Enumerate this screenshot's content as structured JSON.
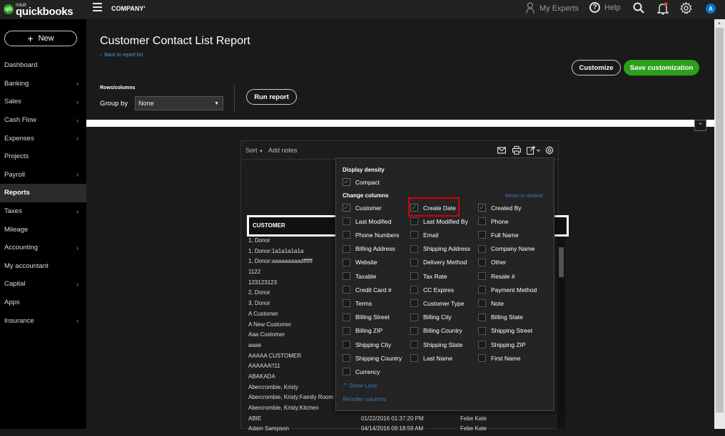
{
  "topbar": {
    "logo_intuit": "intuit",
    "logo_name": "quickbooks",
    "company": "COMPANY'",
    "my_experts": "My Experts",
    "help": "Help",
    "avatar_initial": "A"
  },
  "sidebar": {
    "new_label": "New",
    "items": [
      {
        "label": "Dashboard",
        "chev": false,
        "active": false
      },
      {
        "label": "Banking",
        "chev": true,
        "active": false
      },
      {
        "label": "Sales",
        "chev": true,
        "active": false
      },
      {
        "label": "Cash Flow",
        "chev": true,
        "active": false
      },
      {
        "label": "Expenses",
        "chev": true,
        "active": false
      },
      {
        "label": "Projects",
        "chev": false,
        "active": false
      },
      {
        "label": "Payroll",
        "chev": true,
        "active": false
      },
      {
        "label": "Reports",
        "chev": false,
        "active": true
      },
      {
        "label": "Taxes",
        "chev": true,
        "active": false
      },
      {
        "label": "Mileage",
        "chev": false,
        "active": false
      },
      {
        "label": "Accounting",
        "chev": true,
        "active": false
      },
      {
        "label": "My accountant",
        "chev": false,
        "active": false
      },
      {
        "label": "Capital",
        "chev": true,
        "active": false
      },
      {
        "label": "Apps",
        "chev": false,
        "active": false
      },
      {
        "label": "Insurance",
        "chev": true,
        "active": false
      }
    ]
  },
  "header": {
    "title": "Customer Contact List Report",
    "back_link": "Back to report list",
    "customize": "Customize",
    "save_customization": "Save customization",
    "rows_columns": "Rows/columns",
    "group_by_label": "Group by",
    "group_by_value": "None",
    "run_report": "Run report"
  },
  "report": {
    "sort": "Sort",
    "add_notes": "Add notes",
    "column_customer": "CUSTOMER",
    "rows": [
      {
        "c1": "1, Donor",
        "c2": "",
        "c3": ""
      },
      {
        "c1": "1, Donor:1a1a1a1a1a",
        "c2": "",
        "c3": ""
      },
      {
        "c1": "1, Donor:aaaaaaaaadffffff",
        "c2": "",
        "c3": ""
      },
      {
        "c1": "1122",
        "c2": "",
        "c3": ""
      },
      {
        "c1": "123123123",
        "c2": "",
        "c3": ""
      },
      {
        "c1": "2, Donor",
        "c2": "",
        "c3": ""
      },
      {
        "c1": "3, Donor",
        "c2": "",
        "c3": ""
      },
      {
        "c1": "A Customer",
        "c2": "",
        "c3": ""
      },
      {
        "c1": "A New Customer",
        "c2": "",
        "c3": ""
      },
      {
        "c1": "Aaa Customer",
        "c2": "",
        "c3": ""
      },
      {
        "c1": "aaaa",
        "c2": "",
        "c3": ""
      },
      {
        "c1": "AAAAA CUSTOMER",
        "c2": "",
        "c3": ""
      },
      {
        "c1": "AAAAAA!!11",
        "c2": "",
        "c3": ""
      },
      {
        "c1": "ABAKADA",
        "c2": "",
        "c3": ""
      },
      {
        "c1": "Abercrombie, Kristy",
        "c2": "",
        "c3": ""
      },
      {
        "c1": "Abercrombie, Kristy:Family Room",
        "c2": "",
        "c3": ""
      },
      {
        "c1": "Abercrombie, Kristy:Kitchen",
        "c2": "",
        "c3": ""
      },
      {
        "c1": "ABIE",
        "c2": "01/22/2016 01:37:20 PM",
        "c3": "Febe Kate"
      },
      {
        "c1": "Adam Sampson",
        "c2": "04/14/2016 09:18:59 AM",
        "c3": "Febe Kate"
      }
    ]
  },
  "panel": {
    "display_density": "Display density",
    "compact": "Compact",
    "change_columns": "Change columns",
    "reset_to_default": "Reset to default",
    "show_less": "Show Less",
    "reorder_columns": "Reorder columns",
    "columns": [
      [
        "Customer",
        "Create Date",
        "Created By"
      ],
      [
        "Last Modified",
        "Last Modified By",
        "Phone"
      ],
      [
        "Phone Numbers",
        "Email",
        "Full Name"
      ],
      [
        "Billing Address",
        "Shipping Address",
        "Company Name"
      ],
      [
        "Website",
        "Delivery Method",
        "Other"
      ],
      [
        "Taxable",
        "Tax Rate",
        "Resale #"
      ],
      [
        "Credit Card #",
        "CC Expires",
        "Payment Method"
      ],
      [
        "Terms",
        "Customer Type",
        "Note"
      ],
      [
        "Billing Street",
        "Billing City",
        "Billing State"
      ],
      [
        "Billing ZIP",
        "Billing Country",
        "Shipping Street"
      ],
      [
        "Shipping City",
        "Shipping State",
        "Shipping ZIP"
      ],
      [
        "Shipping Country",
        "Last Name",
        "First Name"
      ],
      [
        "Currency",
        null,
        null
      ]
    ],
    "checked": [
      [
        true,
        true,
        true
      ]
    ]
  }
}
